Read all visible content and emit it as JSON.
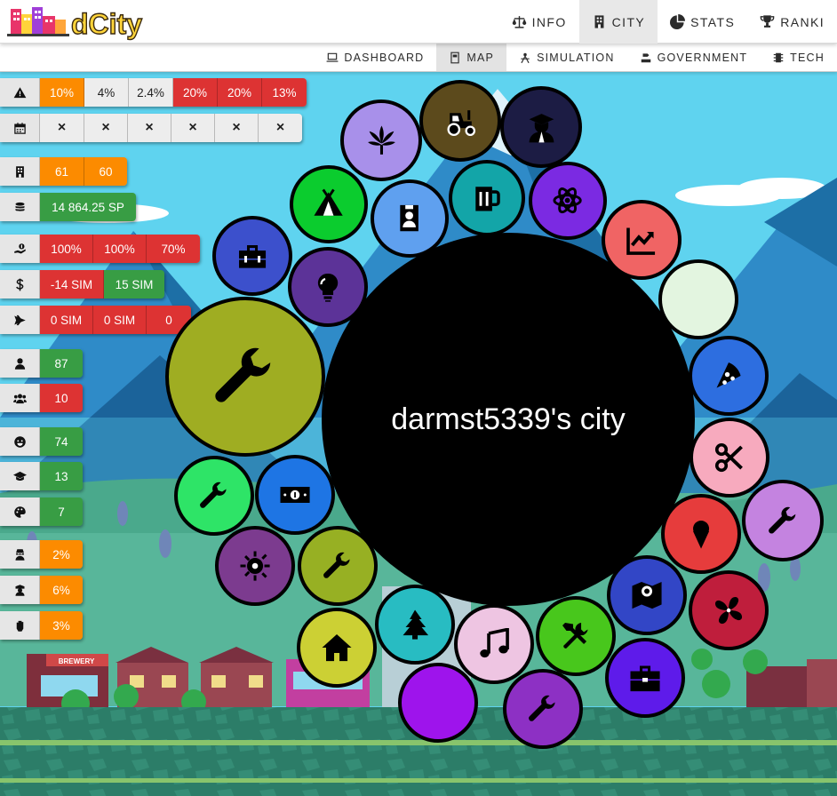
{
  "app": {
    "name": "dCity"
  },
  "nav": {
    "main": [
      {
        "label": "INFO",
        "icon": "scale-icon",
        "active": false
      },
      {
        "label": "CITY",
        "icon": "building-icon",
        "active": true
      },
      {
        "label": "STATS",
        "icon": "pie-chart-icon",
        "active": false
      },
      {
        "label": "RANKI",
        "icon": "trophy-icon",
        "active": false
      }
    ],
    "sub": [
      {
        "label": "DASHBOARD",
        "icon": "laptop-icon",
        "active": false
      },
      {
        "label": "MAP",
        "icon": "map-book-icon",
        "active": true
      },
      {
        "label": "SIMULATION",
        "icon": "simulation-icon",
        "active": false
      },
      {
        "label": "GOVERNMENT",
        "icon": "government-icon",
        "active": false
      },
      {
        "label": "TECH",
        "icon": "chip-icon",
        "active": false
      }
    ]
  },
  "stats": [
    {
      "icon": "warning-icon",
      "cells": [
        {
          "v": "10%",
          "c": "orange"
        },
        {
          "v": "4%",
          "c": "grey"
        },
        {
          "v": "2.4%",
          "c": "grey"
        },
        {
          "v": "20%",
          "c": "red"
        },
        {
          "v": "20%",
          "c": "red"
        },
        {
          "v": "13%",
          "c": "red"
        }
      ]
    },
    {
      "icon": "calendar-icon",
      "cells": [
        {
          "v": "×",
          "c": "grey"
        },
        {
          "v": "×",
          "c": "grey"
        },
        {
          "v": "×",
          "c": "grey"
        },
        {
          "v": "×",
          "c": "grey"
        },
        {
          "v": "×",
          "c": "grey"
        },
        {
          "v": "×",
          "c": "grey"
        }
      ]
    },
    {
      "icon": "building-icon",
      "cells": [
        {
          "v": "61",
          "c": "orange"
        },
        {
          "v": "60",
          "c": "orange"
        }
      ]
    },
    {
      "icon": "coins-icon",
      "cells": [
        {
          "v": "14 864.25 SP",
          "c": "green"
        }
      ]
    },
    {
      "icon": "hand-money-icon",
      "cells": [
        {
          "v": "100%",
          "c": "red"
        },
        {
          "v": "100%",
          "c": "red"
        },
        {
          "v": "70%",
          "c": "red"
        }
      ]
    },
    {
      "icon": "dollar-icon",
      "cells": [
        {
          "v": "-14 SIM",
          "c": "red"
        },
        {
          "v": "15 SIM",
          "c": "green"
        }
      ]
    },
    {
      "icon": "plane-icon",
      "cells": [
        {
          "v": "0 SIM",
          "c": "red"
        },
        {
          "v": "0 SIM",
          "c": "red"
        },
        {
          "v": "0",
          "c": "red"
        }
      ]
    },
    {
      "icon": "user-icon",
      "cells": [
        {
          "v": "87",
          "c": "green"
        }
      ]
    },
    {
      "icon": "users-icon",
      "cells": [
        {
          "v": "10",
          "c": "red"
        }
      ]
    },
    {
      "icon": "smile-icon",
      "cells": [
        {
          "v": "74",
          "c": "green"
        }
      ]
    },
    {
      "icon": "graduation-cap-icon",
      "cells": [
        {
          "v": "13",
          "c": "green"
        }
      ]
    },
    {
      "icon": "palette-icon",
      "cells": [
        {
          "v": "7",
          "c": "green"
        }
      ]
    },
    {
      "icon": "thief-icon",
      "cells": [
        {
          "v": "2%",
          "c": "orange"
        }
      ]
    },
    {
      "icon": "police-icon",
      "cells": [
        {
          "v": "6%",
          "c": "orange"
        }
      ]
    },
    {
      "icon": "fist-icon",
      "cells": [
        {
          "v": "3%",
          "c": "orange"
        }
      ]
    }
  ],
  "city": {
    "name": "darmst5339's city"
  },
  "bubbles": [
    {
      "icon": "tractor-icon",
      "color": "#5c4a1c"
    },
    {
      "icon": "graduate-icon",
      "color": "#1c1c44"
    },
    {
      "icon": "cannabis-leaf-icon",
      "color": "#a890ea"
    },
    {
      "icon": "beer-mug-icon",
      "color": "#13a5a8"
    },
    {
      "icon": "tent-icon",
      "color": "#0bcc2e"
    },
    {
      "icon": "id-badge-icon",
      "color": "#5fa0ef"
    },
    {
      "icon": "atom-icon",
      "color": "#7b2ae2"
    },
    {
      "icon": "chart-line-icon",
      "color": "#f06464"
    },
    {
      "icon": "toolbox-icon",
      "color": "#3c50cc"
    },
    {
      "icon": "lightbulb-icon",
      "color": "#5c3398"
    },
    {
      "icon": "blank-icon",
      "color": "#e3f5e0"
    },
    {
      "icon": "wrench-icon",
      "color": "#9fad22"
    },
    {
      "icon": "pizza-icon",
      "color": "#2d6ee0"
    },
    {
      "icon": "scissors-icon",
      "color": "#f7aabe"
    },
    {
      "icon": "wrench-icon",
      "color": "#2ee467"
    },
    {
      "icon": "money-bill-icon",
      "color": "#1e75e4"
    },
    {
      "icon": "wrench-icon",
      "color": "#c483e0"
    },
    {
      "icon": "ice-cream-icon",
      "color": "#e63c3c"
    },
    {
      "icon": "gear-icon",
      "color": "#7c3b8f"
    },
    {
      "icon": "wrench-icon",
      "color": "#97b023"
    },
    {
      "icon": "map-marker-icon",
      "color": "#3246c6"
    },
    {
      "icon": "fan-icon",
      "color": "#bf1e3c"
    },
    {
      "icon": "house-icon",
      "color": "#ccd034"
    },
    {
      "icon": "tree-icon",
      "color": "#28bcc2"
    },
    {
      "icon": "music-icon",
      "color": "#eec5e2"
    },
    {
      "icon": "tools-icon",
      "color": "#48c71c"
    },
    {
      "icon": "briefcase-icon",
      "color": "#5e1bea"
    },
    {
      "icon": "blank-icon",
      "color": "#9e14ec"
    },
    {
      "icon": "wrench-icon",
      "color": "#8d30c4"
    }
  ],
  "scene": {
    "shop_sign": "BREWERY"
  }
}
